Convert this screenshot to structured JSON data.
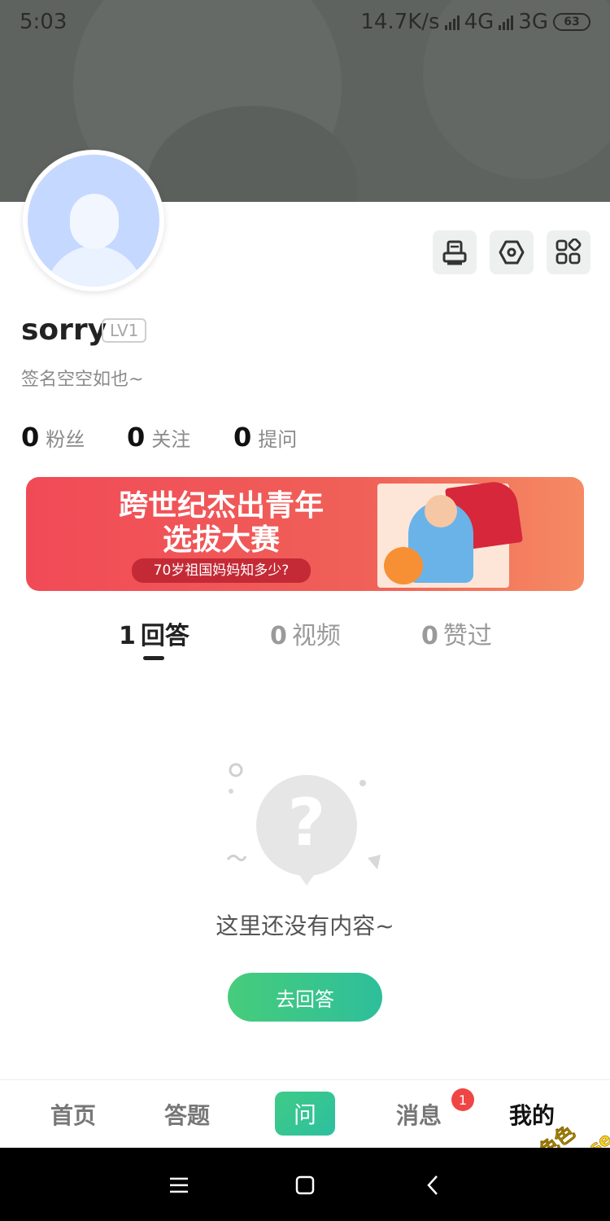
{
  "status_bar": {
    "time": "5:03",
    "net_speed": "14.7K/s",
    "network_1": "4G",
    "network_2": "3G",
    "battery": "63"
  },
  "profile": {
    "username": "sorry",
    "level": "LV1",
    "signature": "签名空空如也~",
    "stats": [
      {
        "value": "0",
        "label": "粉丝"
      },
      {
        "value": "0",
        "label": "关注"
      },
      {
        "value": "0",
        "label": "提问"
      }
    ]
  },
  "actions": {
    "icons": [
      "printer-icon",
      "hexagon-settings-icon",
      "apps-grid-icon"
    ]
  },
  "promo": {
    "title_line1": "跨世纪杰出青年",
    "title_line2": "选拔大赛",
    "subtitle": "70岁祖国妈妈知多少?"
  },
  "tabs": [
    {
      "count": "1",
      "label": "回答"
    },
    {
      "count": "0",
      "label": "视频"
    },
    {
      "count": "0",
      "label": "赞过"
    }
  ],
  "empty_state": {
    "message": "这里还没有内容~",
    "cta_label": "去回答"
  },
  "bottom_nav": {
    "items": [
      "首页",
      "答题",
      "问",
      "消息",
      "我的"
    ],
    "badge": "1"
  },
  "watermark": {
    "line1": "- 免费色色",
    "line2": "www.MFsese.com"
  },
  "colors": {
    "accent_green": "#3fcb86",
    "promo_red": "#f14a57",
    "badge_red": "#f04545"
  }
}
